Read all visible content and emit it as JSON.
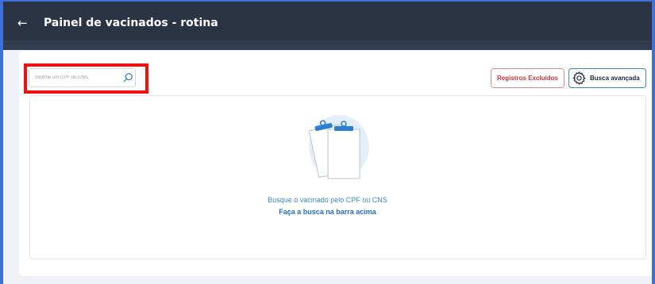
{
  "header": {
    "title": "Painel de vacinados - rotina",
    "back_icon": "arrow-left-icon"
  },
  "search": {
    "placeholder": "Informe um CPF ou CNS",
    "icon": "search-icon"
  },
  "actions": {
    "excluded_label": "Registros Excluídos",
    "advanced_label": "Busca avançada",
    "advanced_icon": "gear-icon"
  },
  "empty_state": {
    "line1": "Busque o vacinado pelo CPF ou CNS",
    "line2": "Faça a busca na barra acima",
    "illustration": "clipboard-icon"
  },
  "colors": {
    "header_bg": "#2b3445",
    "highlight": "#ee1111",
    "accent": "#3a86d6",
    "danger": "#d6343c"
  }
}
